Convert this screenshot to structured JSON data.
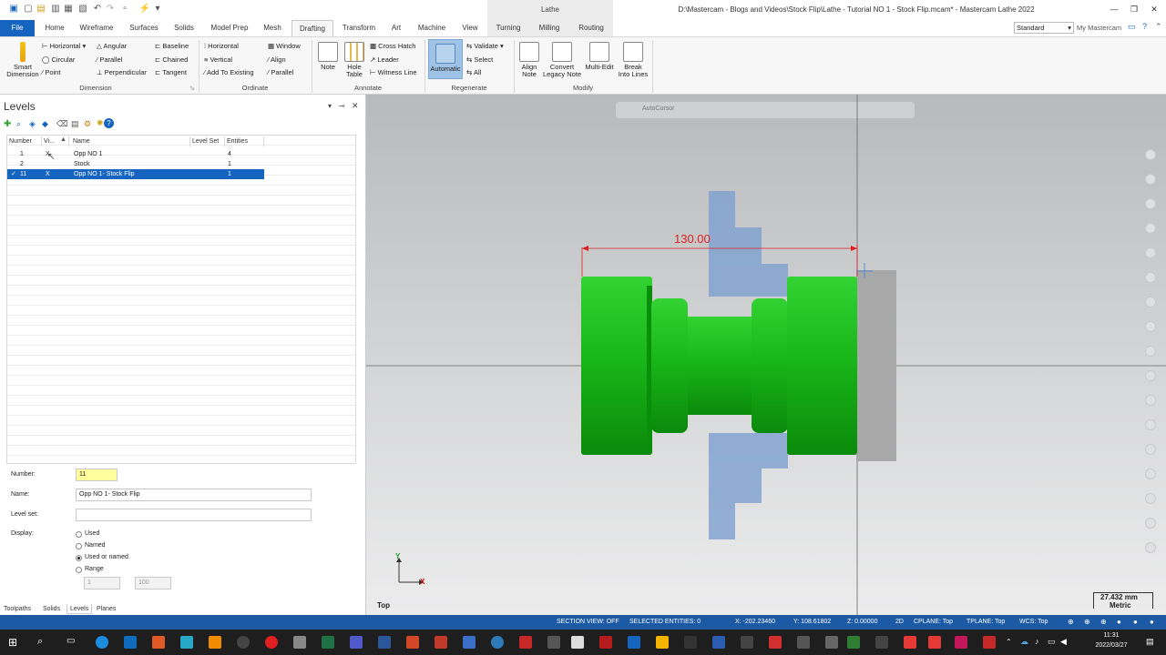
{
  "window": {
    "title": "D:\\Mastercam - Blogs and Videos\\Stock Flip\\Lathe - Tutorial NO 1 - Stock Flip.mcam* - Mastercam Lathe 2022",
    "context_tab_group": "Lathe",
    "workspace": "Standard",
    "my_mastercam": "My Mastercam"
  },
  "tabs": [
    "File",
    "Home",
    "Wireframe",
    "Surfaces",
    "Solids",
    "Model Prep",
    "Mesh",
    "Drafting",
    "Transform",
    "Art",
    "Machine",
    "View",
    "Turning",
    "Milling",
    "Routing"
  ],
  "ribbon": {
    "dimension": {
      "smart_dimension": "Smart\nDimension",
      "horizontal": "Horizontal",
      "angular": "Angular",
      "baseline": "Baseline",
      "circular": "Circular",
      "parallel": "Parallel",
      "chained": "Chained",
      "point": "Point",
      "perpendicular": "Perpendicular",
      "tangent": "Tangent",
      "label": "Dimension"
    },
    "ordinate": {
      "horizontal": "Horizontal",
      "window": "Window",
      "vertical": "Vertical",
      "align": "Align",
      "add_to_existing": "Add To Existing",
      "parallel": "Parallel",
      "label": "Ordinate"
    },
    "annotate": {
      "note": "Note",
      "hole_table": "Hole\nTable",
      "cross_hatch": "Cross Hatch",
      "leader": "Leader",
      "witness_line": "Witness Line",
      "label": "Annotate"
    },
    "regenerate": {
      "automatic": "Automatic",
      "validate": "Validate",
      "select": "Select",
      "all": "All",
      "label": "Regenerate"
    },
    "modify": {
      "align_note": "Align\nNote",
      "convert_legacy_note": "Convert\nLegacy Note",
      "multi_edit": "Multi-Edit",
      "break_into_lines": "Break\nInto Lines",
      "label": "Modify"
    }
  },
  "levels_panel": {
    "title": "Levels",
    "columns": [
      "Number",
      "Vi...",
      "Name",
      "Level Set",
      "Entities"
    ],
    "rows": [
      {
        "number": "1",
        "visible": "X",
        "name": "Opp NO 1",
        "level_set": "",
        "entities": "4"
      },
      {
        "number": "2",
        "visible": "",
        "name": "Stock",
        "level_set": "",
        "entities": "1"
      },
      {
        "number": "11",
        "visible": "X",
        "name": "Opp NO 1- Stock Flip",
        "level_set": "",
        "entities": "1"
      }
    ],
    "selected_row": 2,
    "form": {
      "number_label": "Number:",
      "number_value": "11",
      "name_label": "Name:",
      "name_value": "Opp NO 1- Stock Flip",
      "level_set_label": "Level set:",
      "level_set_value": "",
      "display_label": "Display:",
      "display_options": [
        "Used",
        "Named",
        "Used or named",
        "Range"
      ],
      "display_selected": "Used or named",
      "range_from": "1",
      "range_to": "100"
    },
    "bottom_tabs": [
      "Toolpaths",
      "Solids",
      "Levels",
      "Planes"
    ]
  },
  "viewport": {
    "autocursor": "AutoCursor",
    "dimension_value": "130.00",
    "view_name": "Top",
    "axis_x": "X",
    "axis_y": "Y",
    "scale_value": "27.432 mm",
    "scale_units": "Metric",
    "part_color": "#1fbf1f",
    "stock_color": "#a8a8a8",
    "chuck_color": "#7da0cf",
    "dim_color": "#e02020"
  },
  "status": {
    "section_view": "SECTION VIEW: OFF",
    "selected_entities": "SELECTED ENTITIES: 0",
    "x": "X:    -202.23460",
    "y": "Y:    108.61802",
    "z": "Z:   0.00000",
    "mode": "2D",
    "cplane": "CPLANE: Top",
    "tplane": "TPLANE: Top",
    "wcs": "WCS: Top"
  },
  "taskbar": {
    "time": "11:31",
    "date": "2022/03/27"
  }
}
